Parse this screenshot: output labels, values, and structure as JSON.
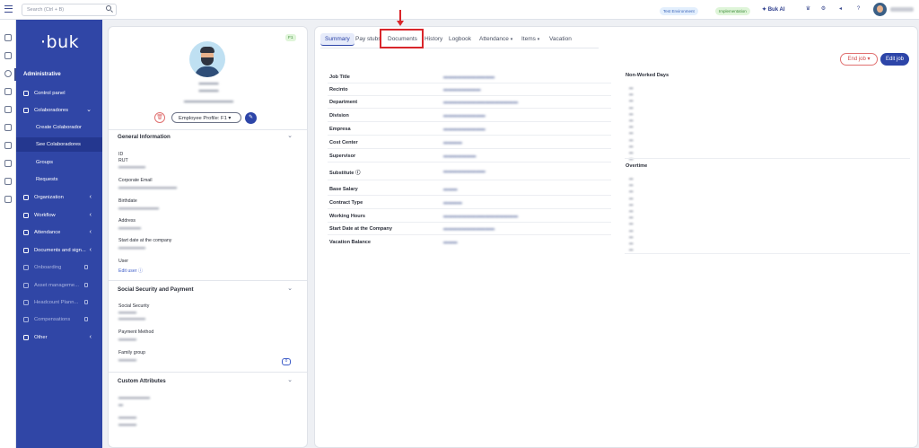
{
  "topbar": {
    "search_placeholder": "Search (Ctrl + B)",
    "env_label": "Test Environment",
    "impl_label": "Implementation",
    "ai_label": "Buk AI"
  },
  "sidebar": {
    "logo": "·buk",
    "heading": "Administrative",
    "items": [
      {
        "label": "Control panel"
      },
      {
        "label": "Colaboradores"
      },
      {
        "label": "Create Colaborador"
      },
      {
        "label": "See Colaboradores"
      },
      {
        "label": "Groups"
      },
      {
        "label": "Requests"
      },
      {
        "label": "Organization"
      },
      {
        "label": "Workflow"
      },
      {
        "label": "Attendance"
      },
      {
        "label": "Documents and sign..."
      },
      {
        "label": "Onboarding"
      },
      {
        "label": "Asset manageme..."
      },
      {
        "label": "Headcount Plann..."
      },
      {
        "label": "Compensations"
      },
      {
        "label": "Other"
      }
    ]
  },
  "profile": {
    "tag": "F1",
    "employee_profile_label": "Employee Profile: F1 ▾",
    "general_title": "General Information",
    "fields": [
      {
        "label": "ID"
      },
      {
        "label": "RUT"
      },
      {
        "label": "Corporate Email"
      },
      {
        "label": "Birthdate"
      },
      {
        "label": "Address"
      },
      {
        "label": "Start date at the company"
      },
      {
        "label": "User"
      }
    ],
    "edit_user": "Edit user",
    "social_title": "Social Security and Payment",
    "social_fields": [
      {
        "label": "Social Security"
      },
      {
        "label": "Payment Method"
      },
      {
        "label": "Family group"
      }
    ],
    "family_count": "0",
    "custom_title": "Custom Attributes"
  },
  "main": {
    "tabs": [
      {
        "label": "Summary"
      },
      {
        "label": "Pay stubs"
      },
      {
        "label": "Documents"
      },
      {
        "label": "History"
      },
      {
        "label": "Logbook"
      },
      {
        "label": "Attendance"
      },
      {
        "label": "Items"
      },
      {
        "label": "Vacation"
      }
    ],
    "end_job": "End job ▾",
    "edit_job": "Edit job",
    "rows": [
      {
        "label": "Job Title"
      },
      {
        "label": "Recinto"
      },
      {
        "label": "Department"
      },
      {
        "label": "Division"
      },
      {
        "label": "Empresa"
      },
      {
        "label": "Cost Center"
      },
      {
        "label": "Supervisor"
      },
      {
        "label": "Substitute"
      },
      {
        "label": "Base Salary"
      },
      {
        "label": "Contract Type"
      },
      {
        "label": "Working Hours"
      },
      {
        "label": "Start Date at the Company"
      },
      {
        "label": "Vacation Balance"
      }
    ],
    "non_worked_title": "Non-Worked Days",
    "overtime_title": "Overtime"
  }
}
